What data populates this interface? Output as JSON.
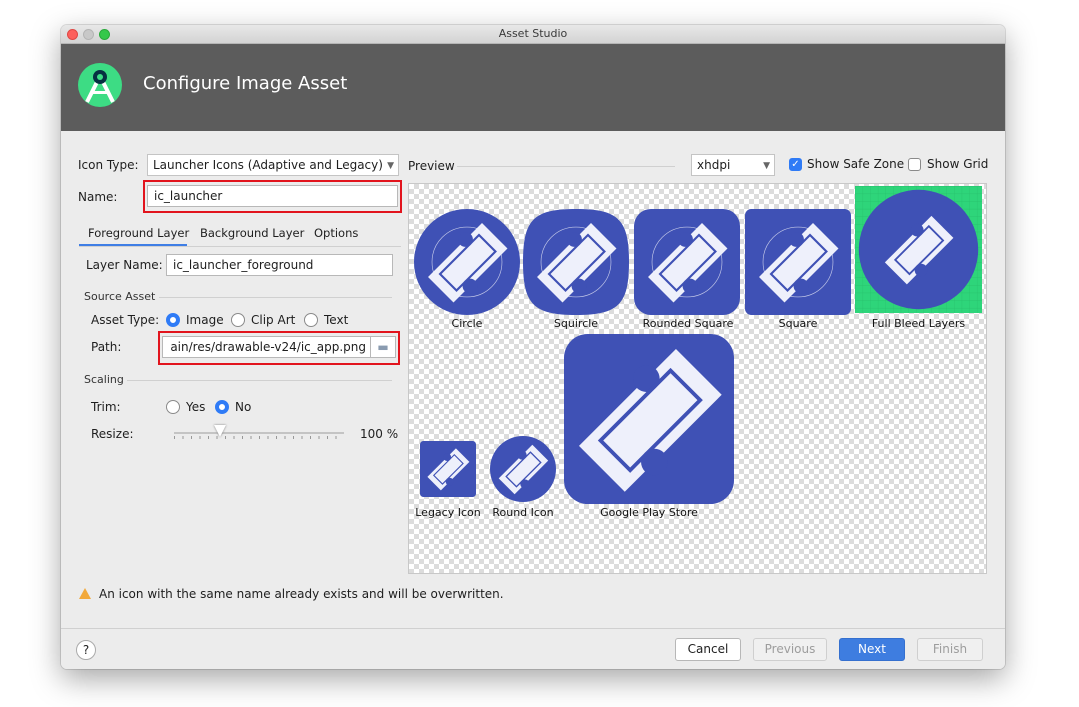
{
  "window": {
    "title": "Asset Studio"
  },
  "header": {
    "title": "Configure Image Asset"
  },
  "form": {
    "icon_type_label": "Icon Type:",
    "icon_type_value": "Launcher Icons (Adaptive and Legacy)",
    "name_label": "Name:",
    "name_value": "ic_launcher",
    "tabs": [
      {
        "label": "Foreground Layer"
      },
      {
        "label": "Background Layer"
      },
      {
        "label": "Options"
      }
    ],
    "layer_name_label": "Layer Name:",
    "layer_name_value": "ic_launcher_foreground",
    "source_asset_label": "Source Asset",
    "asset_type_label": "Asset Type:",
    "asset_types": [
      {
        "label": "Image",
        "selected": true
      },
      {
        "label": "Clip Art",
        "selected": false
      },
      {
        "label": "Text",
        "selected": false
      }
    ],
    "path_label": "Path:",
    "path_value": "ain/res/drawable-v24/ic_app.png",
    "scaling_label": "Scaling",
    "trim_label": "Trim:",
    "trim_options": [
      {
        "label": "Yes",
        "selected": false
      },
      {
        "label": "No",
        "selected": true
      }
    ],
    "resize_label": "Resize:",
    "resize_value": "100 %",
    "resize_fraction": 0.27
  },
  "preview": {
    "label": "Preview",
    "density": "xhdpi",
    "show_safe_zone_label": "Show Safe Zone",
    "show_safe_zone": true,
    "show_grid_label": "Show Grid",
    "show_grid": false,
    "captions": {
      "circle": "Circle",
      "squircle": "Squircle",
      "rounded_square": "Rounded Square",
      "square": "Square",
      "full_bleed": "Full Bleed Layers",
      "legacy": "Legacy Icon",
      "round": "Round Icon",
      "play_store": "Google Play Store"
    },
    "colors": {
      "icon_blue": "#3f51b5",
      "icon_white": "#eef0fb",
      "full_bleed_green": "#2ed57a"
    }
  },
  "warning": {
    "text": "An icon with the same name already exists and will be overwritten."
  },
  "footer": {
    "help": "?",
    "cancel": "Cancel",
    "previous": "Previous",
    "next": "Next",
    "finish": "Finish"
  }
}
